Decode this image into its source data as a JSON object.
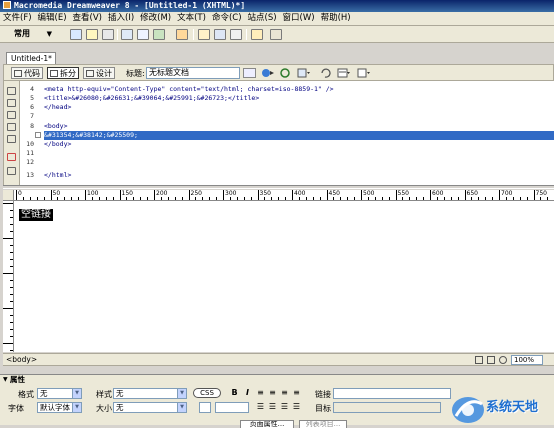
{
  "window": {
    "title": "Macromedia Dreamweaver 8 - [Untitled-1 (XHTML)*]"
  },
  "menu": [
    "文件(F)",
    "编辑(E)",
    "查看(V)",
    "插入(I)",
    "修改(M)",
    "文本(T)",
    "命令(C)",
    "站点(S)",
    "窗口(W)",
    "帮助(H)"
  ],
  "insert_bar": {
    "category": "常用"
  },
  "document": {
    "tab": "Untitled-1*",
    "views": {
      "code": "代码",
      "split": "拆分",
      "design": "设计"
    },
    "title_label": "标题:",
    "title_value": "无标题文档"
  },
  "code": {
    "lines": [
      {
        "num": "4",
        "text": "<meta http-equiv=\"Content-Type\" content=\"text/html; charset=iso-8859-1\" />"
      },
      {
        "num": "5",
        "text": "<title>&#26080;&#26631;&#39064;&#25991;&#26723;</title>"
      },
      {
        "num": "6",
        "text": "</head>"
      },
      {
        "num": "7",
        "text": ""
      },
      {
        "num": "8",
        "text": "<body>"
      },
      {
        "num": "9",
        "text": "&#31354;&#38142;&#25509;"
      },
      {
        "num": "10",
        "text": "</body>"
      },
      {
        "num": "11",
        "text": ""
      },
      {
        "num": "12",
        "text": ""
      },
      {
        "num": "13",
        "text": "</html>"
      }
    ],
    "selected_line": "9"
  },
  "ruler": {
    "labels": [
      "0",
      "50",
      "100",
      "150",
      "200",
      "250",
      "300",
      "350",
      "400",
      "450",
      "500",
      "550",
      "600",
      "650",
      "700",
      "750"
    ]
  },
  "design": {
    "text": "空链接"
  },
  "status": {
    "tag": "<body>",
    "zoom": "100%"
  },
  "properties": {
    "header": "属性",
    "format_label": "格式",
    "format_value": "无",
    "style_label": "样式",
    "style_value": "无",
    "css_label": "CSS",
    "bold": "B",
    "italic": "I",
    "link_label": "链接",
    "font_label": "字体",
    "font_value": "默认字体",
    "size_label": "大小",
    "size_value": "无",
    "target_label": "目标",
    "page_props_label": "页面属性...",
    "list_item_label": "列表项目..."
  },
  "watermark": {
    "text": "系统天地"
  }
}
